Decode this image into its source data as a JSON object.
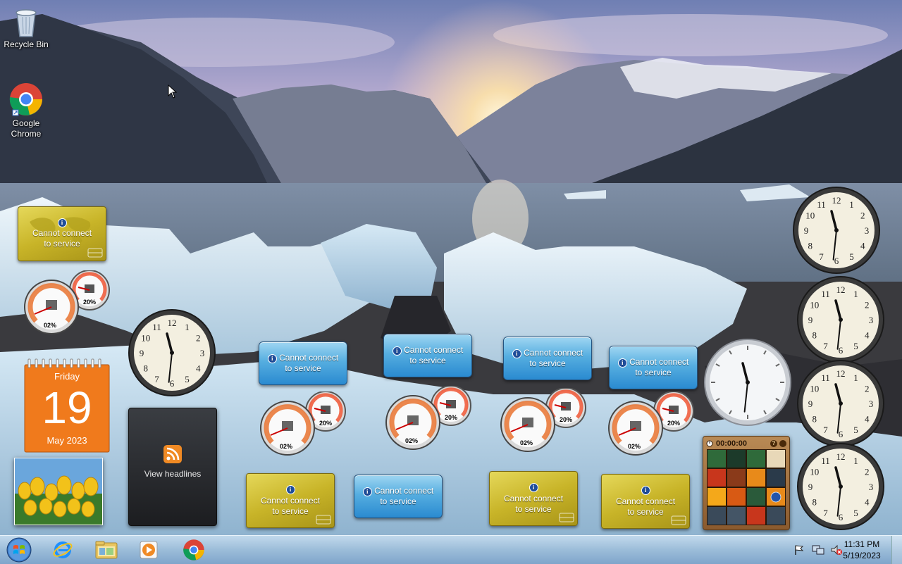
{
  "desktop_icons": [
    {
      "id": "recycle-bin",
      "label": "Recycle Bin"
    },
    {
      "id": "google-chrome",
      "label": "Google Chrome"
    }
  ],
  "weather": {
    "message": "Cannot connect to service",
    "line1": "Cannot connect",
    "line2": "to service"
  },
  "calendar": {
    "weekday": "Friday",
    "day": "19",
    "month_year": "May 2023"
  },
  "feed": {
    "label": "View headlines"
  },
  "cpu_meter": {
    "cpu": "02%",
    "memory": "20%"
  },
  "puzzle": {
    "timer": "00:00:00"
  },
  "clock_time": {
    "hour": 11,
    "minute": 31
  },
  "taskbar": {
    "pinned": [
      "start",
      "internet-explorer",
      "windows-explorer",
      "media-player",
      "google-chrome"
    ],
    "time": "11:31 PM",
    "date": "5/19/2023"
  },
  "colors": {
    "taskbar": "#9fc0dc",
    "calendar": "#f07a1c",
    "weather_blue": "#3d9ad8",
    "weather_gold": "#c9b52a",
    "feed": "#2a2c30"
  }
}
